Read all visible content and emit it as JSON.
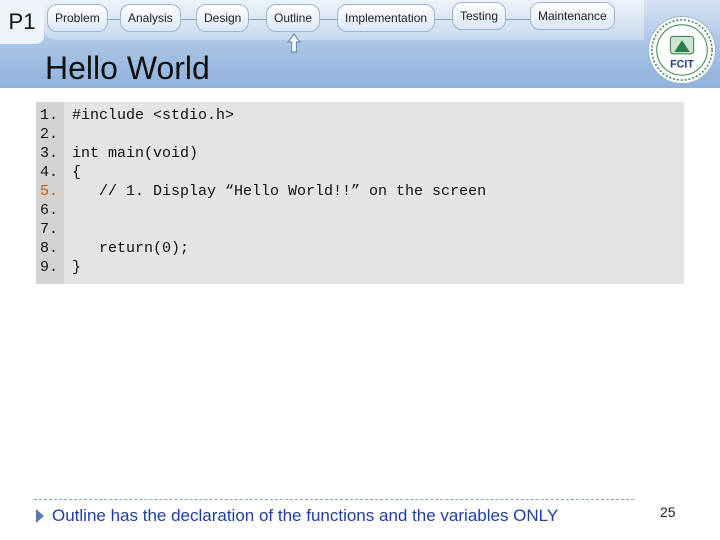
{
  "slide": {
    "badge": "P1",
    "title": "Hello World",
    "page_number": "25"
  },
  "steps": [
    {
      "label": "Problem"
    },
    {
      "label": "Analysis"
    },
    {
      "label": "Design"
    },
    {
      "label": "Outline"
    },
    {
      "label": "Implementation"
    },
    {
      "label": "Testing"
    },
    {
      "label": "Maintenance"
    }
  ],
  "current_step_indicator": "up-arrow-icon",
  "logo": {
    "text": "FCIT"
  },
  "code": {
    "line_numbers": [
      "1.",
      "2.",
      "3.",
      "4.",
      "5.",
      "6.",
      "7.",
      "8.",
      "9."
    ],
    "lines": [
      "#include <stdio.h>",
      "",
      "int main(void)",
      "{",
      "   // 1. Display “Hello World!!” on the screen",
      "",
      "",
      "   return(0);",
      "}"
    ]
  },
  "footer": {
    "note": "Outline has the declaration of the functions and the variables ONLY"
  },
  "colors": {
    "header": "#a6c2e4",
    "footer_text": "#1f3fa0",
    "code_bg": "#e4e4e4",
    "highlight_line_number": "#c85a00"
  }
}
